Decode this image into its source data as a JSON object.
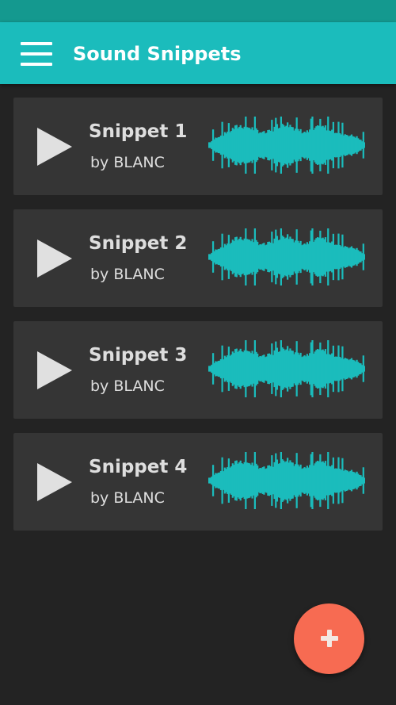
{
  "header": {
    "title": "Sound Snippets",
    "menu_icon": "hamburger-menu-icon"
  },
  "snippets": [
    {
      "title": "Snippet 1",
      "author": "by BLANC"
    },
    {
      "title": "Snippet 2",
      "author": "by BLANC"
    },
    {
      "title": "Snippet 3",
      "author": "by BLANC"
    },
    {
      "title": "Snippet 4",
      "author": "by BLANC"
    }
  ],
  "fab": {
    "icon": "plus-icon"
  },
  "colors": {
    "status_bar": "#14998f",
    "app_bar": "#1bbcbc",
    "background": "#232323",
    "card": "#353535",
    "waveform": "#1bbcbc",
    "play_icon": "#e0e0e0",
    "fab": "#f76b52"
  }
}
